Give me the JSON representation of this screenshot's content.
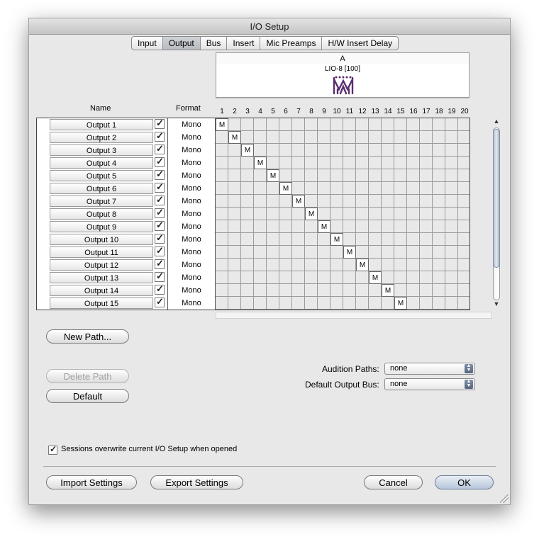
{
  "window": {
    "title": "I/O Setup"
  },
  "tabs": [
    {
      "label": "Input",
      "active": false
    },
    {
      "label": "Output",
      "active": true
    },
    {
      "label": "Bus",
      "active": false
    },
    {
      "label": "Insert",
      "active": false
    },
    {
      "label": "Mic Preamps",
      "active": false
    },
    {
      "label": "H/W Insert Delay",
      "active": false
    }
  ],
  "table": {
    "name_header": "Name",
    "format_header": "Format",
    "device_group": "A",
    "device_name": "LIO-8 [100]",
    "channels": [
      "1",
      "2",
      "3",
      "4",
      "5",
      "6",
      "7",
      "8",
      "9",
      "10",
      "11",
      "12",
      "13",
      "14",
      "15",
      "16",
      "17",
      "18",
      "19",
      "20"
    ],
    "assign_mark": "M",
    "rows": [
      {
        "name": "Output 1",
        "format": "Mono",
        "channel": 1
      },
      {
        "name": "Output 2",
        "format": "Mono",
        "channel": 2
      },
      {
        "name": "Output 3",
        "format": "Mono",
        "channel": 3
      },
      {
        "name": "Output 4",
        "format": "Mono",
        "channel": 4
      },
      {
        "name": "Output 5",
        "format": "Mono",
        "channel": 5
      },
      {
        "name": "Output 6",
        "format": "Mono",
        "channel": 6
      },
      {
        "name": "Output 7",
        "format": "Mono",
        "channel": 7
      },
      {
        "name": "Output 8",
        "format": "Mono",
        "channel": 8
      },
      {
        "name": "Output 9",
        "format": "Mono",
        "channel": 9
      },
      {
        "name": "Output 10",
        "format": "Mono",
        "channel": 10
      },
      {
        "name": "Output 11",
        "format": "Mono",
        "channel": 11
      },
      {
        "name": "Output 12",
        "format": "Mono",
        "channel": 12
      },
      {
        "name": "Output 13",
        "format": "Mono",
        "channel": 13
      },
      {
        "name": "Output 14",
        "format": "Mono",
        "channel": 14
      },
      {
        "name": "Output 15",
        "format": "Mono",
        "channel": 15
      }
    ]
  },
  "buttons": {
    "new_path": "New Path...",
    "delete_path": "Delete Path",
    "default": "Default",
    "import_settings": "Import Settings",
    "export_settings": "Export Settings",
    "cancel": "Cancel",
    "ok": "OK"
  },
  "audition": {
    "label": "Audition Paths:",
    "value": "none"
  },
  "default_output": {
    "label": "Default Output Bus:",
    "value": "none"
  },
  "sessions_overwrite": {
    "label": "Sessions overwrite current I/O Setup when opened",
    "checked": true
  },
  "colors": {
    "ok_button": "#b6c6da",
    "logo": "#5a2d6e"
  }
}
